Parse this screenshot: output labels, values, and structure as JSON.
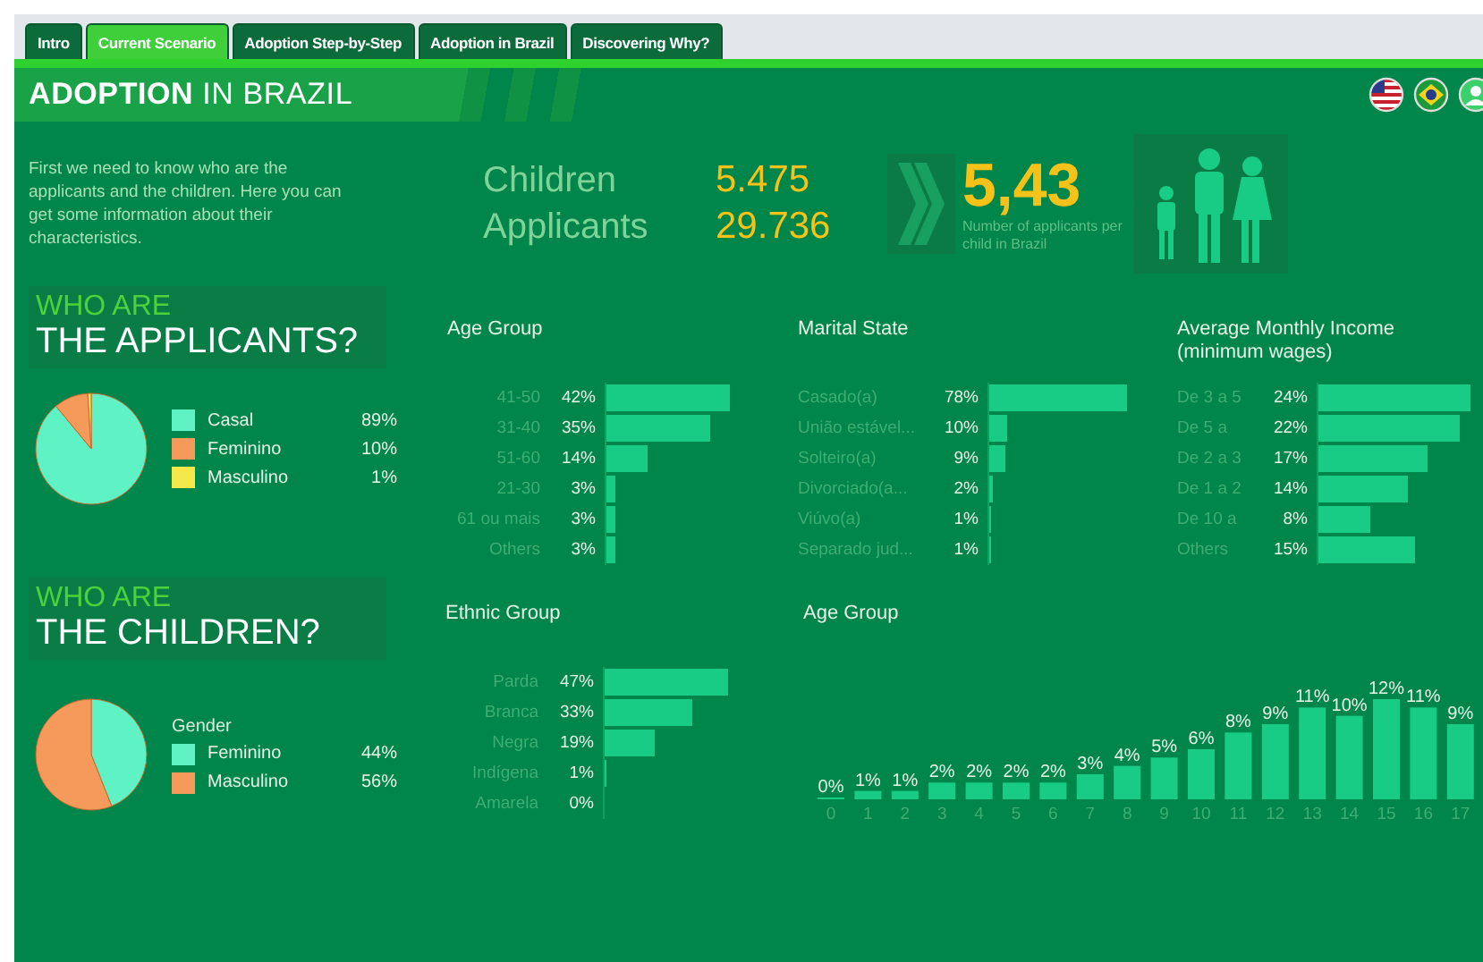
{
  "tabs": [
    {
      "label": "Intro",
      "selected": false
    },
    {
      "label": "Current Scenario",
      "selected": true
    },
    {
      "label": "Adoption Step-by-Step",
      "selected": false
    },
    {
      "label": "Adoption in Brazil",
      "selected": false
    },
    {
      "label": "Discovering Why?",
      "selected": false
    }
  ],
  "header": {
    "title": "**ADOPTION** IN BRAZIL"
  },
  "intro": {
    "text": "First we need to know who are the applicants and the children. Here you can get some information about their characteristics.",
    "stats": [
      {
        "label": "Children",
        "value": "5.475"
      },
      {
        "label": "Applicants",
        "value": "29.736"
      }
    ],
    "ratio": {
      "value": "5,43",
      "caption": "Number of applicants per child in Brazil"
    }
  },
  "sections": [
    {
      "title_top": "WHO ARE",
      "title_main": "THE APPLICANTS?",
      "pie": {
        "chart_data": {
          "type": "pie",
          "values": [
            89,
            10,
            1
          ]
        },
        "legend": [
          {
            "label": "Casal",
            "value": "89%",
            "color": "#5ef2c4"
          },
          {
            "label": "Feminino",
            "value": "10%",
            "color": "#f59a5a"
          },
          {
            "label": "Masculino",
            "value": "1%",
            "color": "#f5e84a"
          }
        ]
      },
      "charts": [
        {
          "chart_data": {
            "type": "bar",
            "orientation": "horizontal",
            "grid": true,
            "title": "Age Group",
            "categories": [
              "41-50",
              "31-40",
              "51-60",
              "21-30",
              "61 ou mais",
              "Others"
            ],
            "values": [
              42,
              35,
              14,
              3,
              3,
              3
            ],
            "value_labels": [
              "42%",
              "35%",
              "14%",
              "3%",
              "3%",
              "3%"
            ]
          }
        },
        {
          "chart_data": {
            "type": "bar",
            "orientation": "horizontal",
            "grid": true,
            "title": "Marital State",
            "categories": [
              "Casado(a)",
              "União estável...",
              "Solteiro(a)",
              "Divorciado(a...",
              "Viúvo(a)",
              "Separado jud..."
            ],
            "values": [
              78,
              10,
              9,
              2,
              1,
              1
            ],
            "value_labels": [
              "78%",
              "10%",
              "9%",
              "2%",
              "1%",
              "1%"
            ]
          }
        },
        {
          "chart_data": {
            "type": "bar",
            "orientation": "horizontal",
            "grid": true,
            "title": "Average Monthly Income (minimum wages)",
            "categories": [
              "De 3 a 5",
              "De 5 a",
              "De 2 a 3",
              "De 1 a 2",
              "De 10 a",
              "Others"
            ],
            "values": [
              24,
              22,
              17,
              14,
              8,
              15
            ],
            "value_labels": [
              "24%",
              "22%",
              "17%",
              "14%",
              "8%",
              "15%"
            ]
          }
        }
      ]
    },
    {
      "title_top": "WHO ARE",
      "title_main": "THE CHILDREN?",
      "pie": {
        "legend_title": "Gender",
        "chart_data": {
          "type": "pie",
          "values": [
            44,
            56
          ]
        },
        "legend": [
          {
            "label": "Feminino",
            "value": "44%",
            "color": "#5ef2c4"
          },
          {
            "label": "Masculino",
            "value": "56%",
            "color": "#f59a5a"
          }
        ]
      },
      "charts": [
        {
          "chart_data": {
            "type": "bar",
            "orientation": "horizontal",
            "grid": true,
            "title": "Ethnic Group",
            "categories": [
              "Parda",
              "Branca",
              "Negra",
              "Indígena",
              "Amarela"
            ],
            "values": [
              47,
              33,
              19,
              1,
              0
            ],
            "value_labels": [
              "47%",
              "33%",
              "19%",
              "1%",
              "0%"
            ]
          }
        },
        {
          "chart_data": {
            "type": "bar",
            "orientation": "vertical",
            "title": "Age Group",
            "categories": [
              "0",
              "1",
              "2",
              "3",
              "4",
              "5",
              "6",
              "7",
              "8",
              "9",
              "10",
              "11",
              "12",
              "13",
              "14",
              "15",
              "16",
              "17"
            ],
            "values": [
              0,
              1,
              1,
              2,
              2,
              2,
              2,
              3,
              4,
              5,
              6,
              8,
              9,
              11,
              10,
              12,
              11,
              9
            ],
            "value_labels": [
              "0%",
              "1%",
              "1%",
              "2%",
              "2%",
              "2%",
              "2%",
              "3%",
              "4%",
              "5%",
              "6%",
              "8%",
              "9%",
              "11%",
              "10%",
              "12%",
              "11%",
              "9%"
            ]
          }
        }
      ]
    }
  ]
}
